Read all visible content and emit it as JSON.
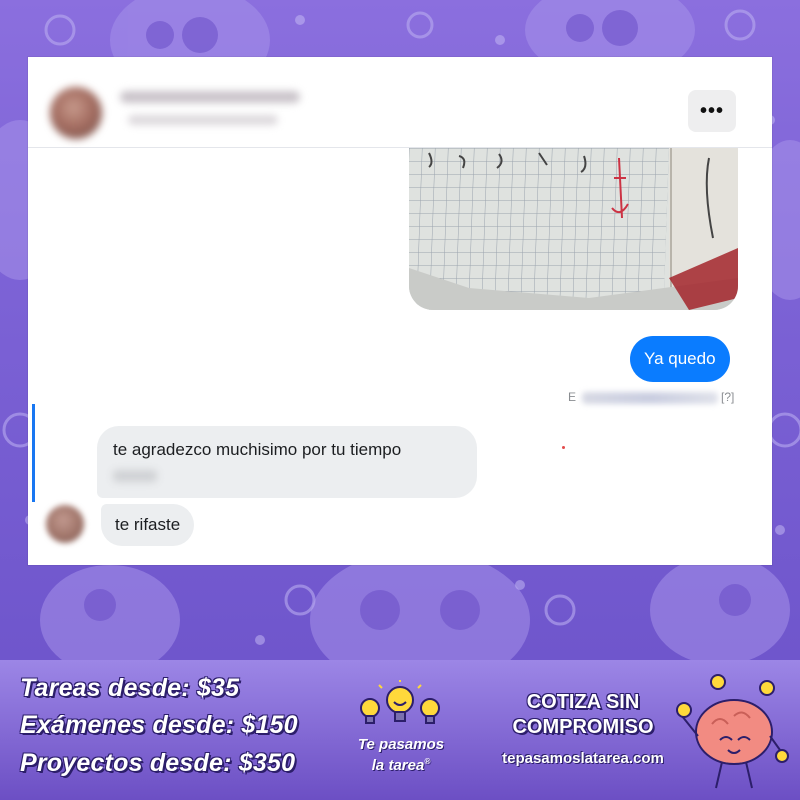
{
  "chat": {
    "header": {
      "more_icon": "more-horizontal-icon",
      "more_label": "•••"
    },
    "outgoing_text": "Ya quedo",
    "seen": {
      "prefix": "E",
      "help": "[?]"
    },
    "incoming_1": "te agradezco muchisimo por tu tiempo",
    "incoming_2": "te rifaste",
    "colors": {
      "outgoing_bubble": "#0a7cff",
      "incoming_bubble": "#eceef0",
      "highlight_bar": "#1877f2"
    }
  },
  "footer": {
    "prices": [
      "Tareas desde: $35",
      "Exámenes desde: $150",
      "Proyectos desde: $350"
    ],
    "logo_line1": "Te pasamos",
    "logo_line2": "la tarea",
    "logo_mark": "®",
    "cta_line1": "COTIZA SIN",
    "cta_line2": "COMPROMISO",
    "website": "tepasamoslatarea.com",
    "colors": {
      "background_top": "#9c86e6",
      "background_bottom": "#6c4fc4",
      "text_outline": "#2c1e6a",
      "brain": "#f28b82",
      "bulb": "#ffd93b"
    }
  }
}
